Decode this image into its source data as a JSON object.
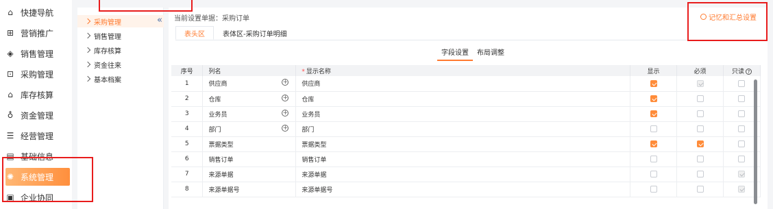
{
  "sidebar": {
    "items": [
      {
        "label": "快捷导航",
        "icon": "home-icon"
      },
      {
        "label": "营销推广",
        "icon": "gift-icon"
      },
      {
        "label": "销售管理",
        "icon": "diamond-icon"
      },
      {
        "label": "采购管理",
        "icon": "bag-icon"
      },
      {
        "label": "库存核算",
        "icon": "warehouse-icon"
      },
      {
        "label": "资金管理",
        "icon": "money-bag-icon"
      },
      {
        "label": "经营管理",
        "icon": "document-icon"
      },
      {
        "label": "基础信息",
        "icon": "id-card-icon"
      },
      {
        "label": "系统管理",
        "icon": "settings-icon"
      },
      {
        "label": "企业协同",
        "icon": "collab-icon"
      }
    ],
    "active_index": 8
  },
  "submenu": {
    "items": [
      "采购管理",
      "销售管理",
      "库存核算",
      "资金往来",
      "基本档案"
    ],
    "active_index": 0
  },
  "main": {
    "current_doc": "当前设置单据：采购订单",
    "memory_button": "记忆和汇总设置",
    "tabs": [
      "表头区",
      "表体区-采购订单明细"
    ],
    "active_tab": 0,
    "subtabs": [
      "字段设置",
      "布局调整"
    ],
    "active_subtab": 0
  },
  "table": {
    "headers": [
      "序号",
      "列名",
      "显示名称",
      "显示",
      "必须",
      "只读"
    ],
    "rows": [
      {
        "no": "1",
        "col": "供应商",
        "display": "供应商",
        "add": true,
        "show": "on",
        "required": "dis",
        "readonly": "off"
      },
      {
        "no": "2",
        "col": "仓库",
        "display": "仓库",
        "add": true,
        "show": "on",
        "required": "off",
        "readonly": "off"
      },
      {
        "no": "3",
        "col": "业务员",
        "display": "业务员",
        "add": true,
        "show": "on",
        "required": "off",
        "readonly": "off"
      },
      {
        "no": "4",
        "col": "部门",
        "display": "部门",
        "add": true,
        "show": "off",
        "required": "off",
        "readonly": "off"
      },
      {
        "no": "5",
        "col": "票据类型",
        "display": "票据类型",
        "add": false,
        "show": "on",
        "required": "on",
        "readonly": "off"
      },
      {
        "no": "6",
        "col": "销售订单",
        "display": "销售订单",
        "add": false,
        "show": "off",
        "required": "off",
        "readonly": "off"
      },
      {
        "no": "7",
        "col": "来源单据",
        "display": "来源单据",
        "add": false,
        "show": "off",
        "required": "off",
        "readonly": "dis"
      },
      {
        "no": "8",
        "col": "来源单据号",
        "display": "来源单据号",
        "add": false,
        "show": "off",
        "required": "off",
        "readonly": "dis"
      }
    ]
  },
  "colors": {
    "accent": "#ff7a2f",
    "annotation": "#e81c1c"
  }
}
